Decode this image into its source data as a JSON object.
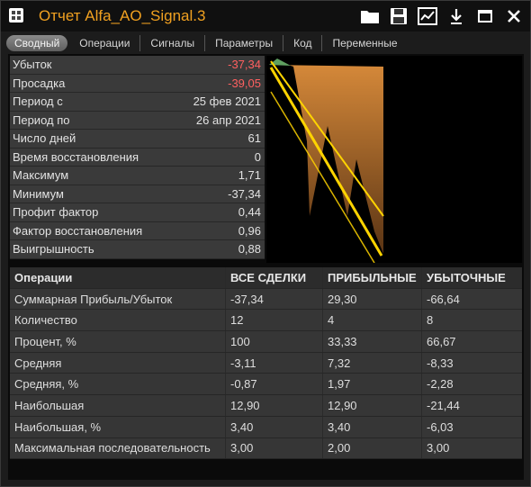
{
  "window": {
    "title": "Отчет Alfa_AO_Signal.3",
    "icons": [
      "folder-icon",
      "save-icon",
      "chart-settings-icon",
      "download-arrow-icon",
      "maximize-icon",
      "close-icon"
    ]
  },
  "tabs": [
    {
      "label": "Сводный",
      "active": true
    },
    {
      "label": "Операции",
      "active": false
    },
    {
      "label": "Сигналы",
      "active": false
    },
    {
      "label": "Параметры",
      "active": false
    },
    {
      "label": "Код",
      "active": false
    },
    {
      "label": "Переменные",
      "active": false
    }
  ],
  "stats": [
    {
      "label": "Убыток",
      "value": "-37,34",
      "negative": true
    },
    {
      "label": "Просадка",
      "value": "-39,05",
      "negative": true
    },
    {
      "label": "Период с",
      "value": "25 фев 2021",
      "negative": false
    },
    {
      "label": "Период по",
      "value": "26 апр 2021",
      "negative": false
    },
    {
      "label": "Число дней",
      "value": "61",
      "negative": false
    },
    {
      "label": "Время восстановления",
      "value": "0",
      "negative": false
    },
    {
      "label": "Максимум",
      "value": "1,71",
      "negative": false
    },
    {
      "label": "Минимум",
      "value": "-37,34",
      "negative": false
    },
    {
      "label": "Профит фактор",
      "value": "0,44",
      "negative": false
    },
    {
      "label": "Фактор восстановления",
      "value": "0,96",
      "negative": false
    },
    {
      "label": "Выигрышность",
      "value": "0,88",
      "negative": false
    }
  ],
  "operations_table": {
    "headers": [
      "Операции",
      "ВСЕ СДЕЛКИ",
      "ПРИБЫЛЬНЫЕ",
      "УБЫТОЧНЫЕ"
    ],
    "rows": [
      [
        "Суммарная Прибыль/Убыток",
        "-37,34",
        "29,30",
        "-66,64"
      ],
      [
        "Количество",
        "12",
        "4",
        "8"
      ],
      [
        "Процент, %",
        "100",
        "33,33",
        "66,67"
      ],
      [
        "Средняя",
        "-3,11",
        "7,32",
        "-8,33"
      ],
      [
        "Средняя, %",
        "-0,87",
        "1,97",
        "-2,28"
      ],
      [
        "Наибольшая",
        "12,90",
        "12,90",
        "-21,44"
      ],
      [
        "Наибольшая, %",
        "3,40",
        "3,40",
        "-6,03"
      ],
      [
        "Максимальная последовательность",
        "3,00",
        "2,00",
        "3,00"
      ]
    ]
  },
  "colors": {
    "title": "#f0a020",
    "negative": "#ff6060",
    "area_top": "#d78a3a",
    "area_bottom": "#5a3414",
    "trend_line": "#ffd400",
    "profit_area": "#5fa060"
  }
}
